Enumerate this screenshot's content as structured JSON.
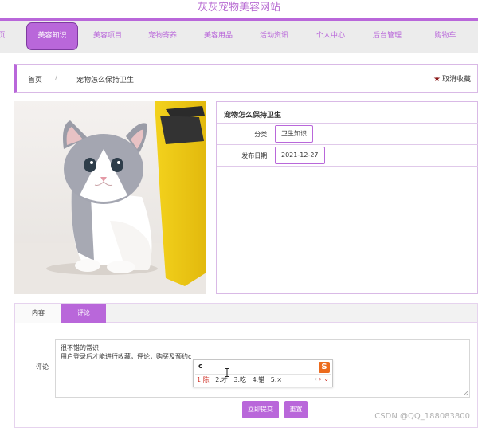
{
  "site": {
    "title": "灰灰宠物美容网站"
  },
  "nav": {
    "items": [
      {
        "label": "页"
      },
      {
        "label": "美容知识"
      },
      {
        "label": "美容项目"
      },
      {
        "label": "宠物寄养"
      },
      {
        "label": "美容用品"
      },
      {
        "label": "活动资讯"
      },
      {
        "label": "个人中心"
      },
      {
        "label": "后台管理"
      },
      {
        "label": "购物车"
      }
    ],
    "active_index": 1
  },
  "breadcrumb": {
    "home": "首页",
    "separator": "/",
    "current": "宠物怎么保持卫生"
  },
  "favorite": {
    "icon": "star-icon",
    "label": "取消收藏"
  },
  "article": {
    "title": "宠物怎么保持卫生",
    "category_label": "分类:",
    "category_value": "卫生知识",
    "date_label": "发布日期:",
    "date_value": "2021-12-27"
  },
  "tabs": [
    {
      "label": "内容"
    },
    {
      "label": "评论"
    }
  ],
  "active_tab": 1,
  "comment": {
    "label": "评论",
    "line1": "很不错的常识",
    "line2": "用户登录后才能进行收藏，评论，购买及预约c"
  },
  "ime": {
    "input": "c",
    "logo": "S",
    "candidates": [
      "1.陈",
      "2.才",
      "3.吃",
      "4.错",
      "5.×"
    ],
    "prev": "‹",
    "next": "›",
    "more": "⌄"
  },
  "buttons": {
    "submit": "立即提交",
    "reset": "重置"
  },
  "watermark": "CSDN @QQ_188083800",
  "colors": {
    "accent": "#b967da",
    "title": "#b96fd3",
    "star": "#8b1a1a",
    "ime_orange": "#ec6b1d"
  }
}
